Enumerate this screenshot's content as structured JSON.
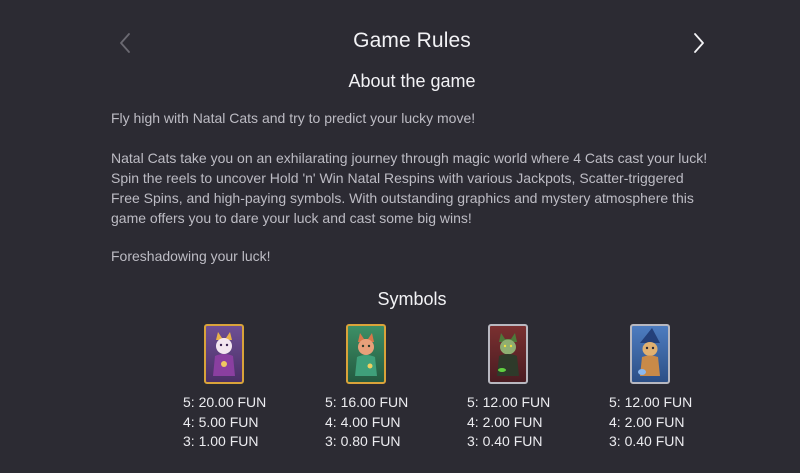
{
  "header": {
    "title": "Game Rules",
    "prev_icon": "chevron-left-icon",
    "next_icon": "chevron-right-icon"
  },
  "about": {
    "title": "About the game",
    "paragraphs": [
      "Fly high with Natal Cats and try to predict your lucky move!",
      "Natal Cats take you on an exhilarating journey through magic world where 4 Cats cast your luck! Spin the reels to uncover Hold 'n' Win Natal Respins with various Jackpots, Scatter-triggered Free Spins, and high-paying symbols. With outstanding graphics and mystery atmosphere this game offers you to dare your luck and cast some big wins!",
      "Foreshadowing your luck!"
    ]
  },
  "symbols": {
    "title": "Symbols",
    "items": [
      {
        "icon": "purple-cat-symbol",
        "frame_color": "#d9a33a",
        "bg_color": "#5a3f7a",
        "pays": [
          "5: 20.00 FUN",
          "4: 5.00 FUN",
          "3: 1.00 FUN"
        ]
      },
      {
        "icon": "green-cat-symbol",
        "frame_color": "#d9a33a",
        "bg_color": "#2f7a55",
        "pays": [
          "5: 16.00 FUN",
          "4: 4.00 FUN",
          "3: 0.80 FUN"
        ]
      },
      {
        "icon": "witch-cat-symbol",
        "frame_color": "#b8b8c0",
        "bg_color": "#6a2a2a",
        "pays": [
          "5: 12.00 FUN",
          "4: 2.00 FUN",
          "3: 0.40 FUN"
        ]
      },
      {
        "icon": "wizard-cat-symbol",
        "frame_color": "#b8b8c0",
        "bg_color": "#3d6aa8",
        "pays": [
          "5: 12.00 FUN",
          "4: 2.00 FUN",
          "3: 0.40 FUN"
        ]
      }
    ]
  }
}
